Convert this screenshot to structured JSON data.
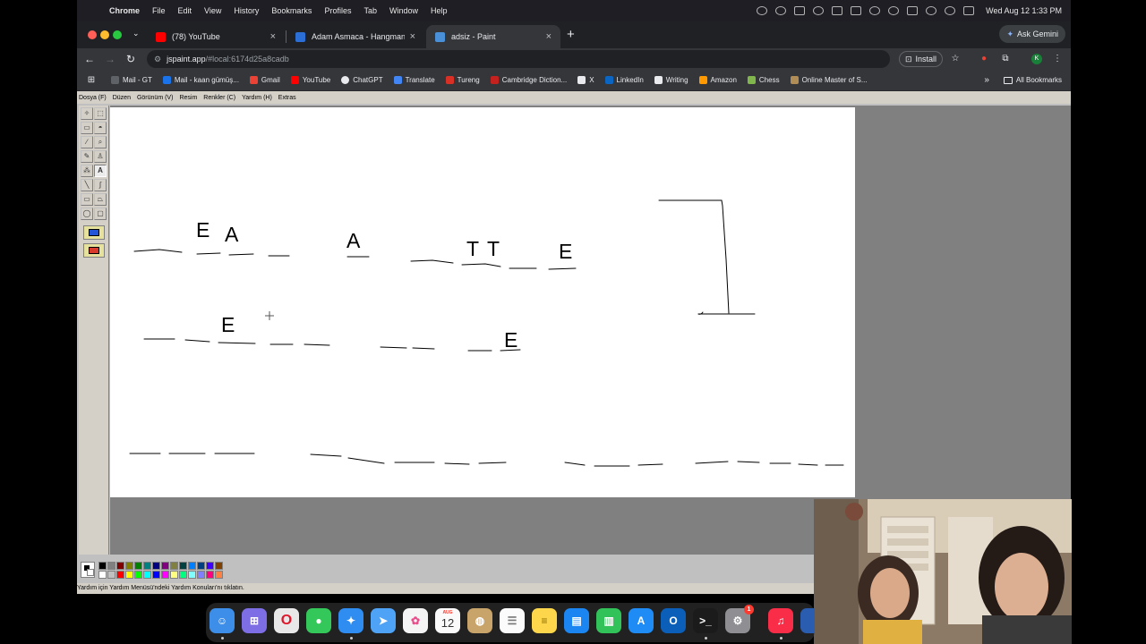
{
  "mac_menubar": {
    "app_name": "Chrome",
    "items": [
      "File",
      "Edit",
      "View",
      "History",
      "Bookmarks",
      "Profiles",
      "Tab",
      "Window",
      "Help"
    ],
    "clock": "Wed Aug 12  1:33 PM"
  },
  "tabs": [
    {
      "title": "(78) YouTube",
      "favicon_color": "#ff0000",
      "active": false
    },
    {
      "title": "Adam Asmaca - Hangman",
      "favicon_color": "#2b6fd6",
      "active": false
    },
    {
      "title": "adsiz - Paint",
      "favicon_color": "#4a90d9",
      "active": true
    }
  ],
  "ask_gemini_label": "Ask Gemini",
  "omnibox": {
    "host": "jspaint.app",
    "path": "/#local:6174d25a8cadb"
  },
  "install_label": "Install",
  "profile_initial": "K",
  "bookmarks": [
    {
      "label": "Mail - GT",
      "color": "#5f6368"
    },
    {
      "label": "Mail - kaan gümüş...",
      "color": "#1a73e8"
    },
    {
      "label": "Gmail",
      "color": "#ea4335"
    },
    {
      "label": "YouTube",
      "color": "#ff0000"
    },
    {
      "label": "ChatGPT",
      "color": "#e8eaed"
    },
    {
      "label": "Translate",
      "color": "#4285f4"
    },
    {
      "label": "Tureng",
      "color": "#d93025"
    },
    {
      "label": "Cambridge Diction...",
      "color": "#c5221f"
    },
    {
      "label": "X",
      "color": "#e8eaed"
    },
    {
      "label": "LinkedIn",
      "color": "#0a66c2"
    },
    {
      "label": "Writing",
      "color": "#e8eaed"
    },
    {
      "label": "Amazon",
      "color": "#ff9900"
    },
    {
      "label": "Chess",
      "color": "#81b64c"
    },
    {
      "label": "Online Master of S...",
      "color": "#b08d57"
    }
  ],
  "all_bookmarks_label": "All Bookmarks",
  "paint": {
    "menu": [
      "Dosya (F)",
      "Düzen",
      "Görünüm (V)",
      "Resim",
      "Renkler (C)",
      "Yardım (H)",
      "Extras"
    ],
    "canvas_letters": [
      "E",
      "A",
      "A",
      "T",
      "T",
      "E",
      "E",
      "E"
    ],
    "status_text": "Yardım için Yardım Menüsü'ndeki Yardım Konuları'nı tıklatın.",
    "palette": [
      "#000000",
      "#808080",
      "#800000",
      "#808000",
      "#008000",
      "#008080",
      "#000080",
      "#800080",
      "#808040",
      "#004040",
      "#0080ff",
      "#004080",
      "#4000ff",
      "#804000",
      "#ffffff",
      "#c0c0c0",
      "#ff0000",
      "#ffff00",
      "#00ff00",
      "#00ffff",
      "#0000ff",
      "#ff00ff",
      "#ffff80",
      "#00ff80",
      "#80ffff",
      "#8080ff",
      "#ff0080",
      "#ff8040"
    ]
  },
  "dock": {
    "calendar_month": "AUG",
    "calendar_day": "12",
    "music_badge": "1"
  }
}
